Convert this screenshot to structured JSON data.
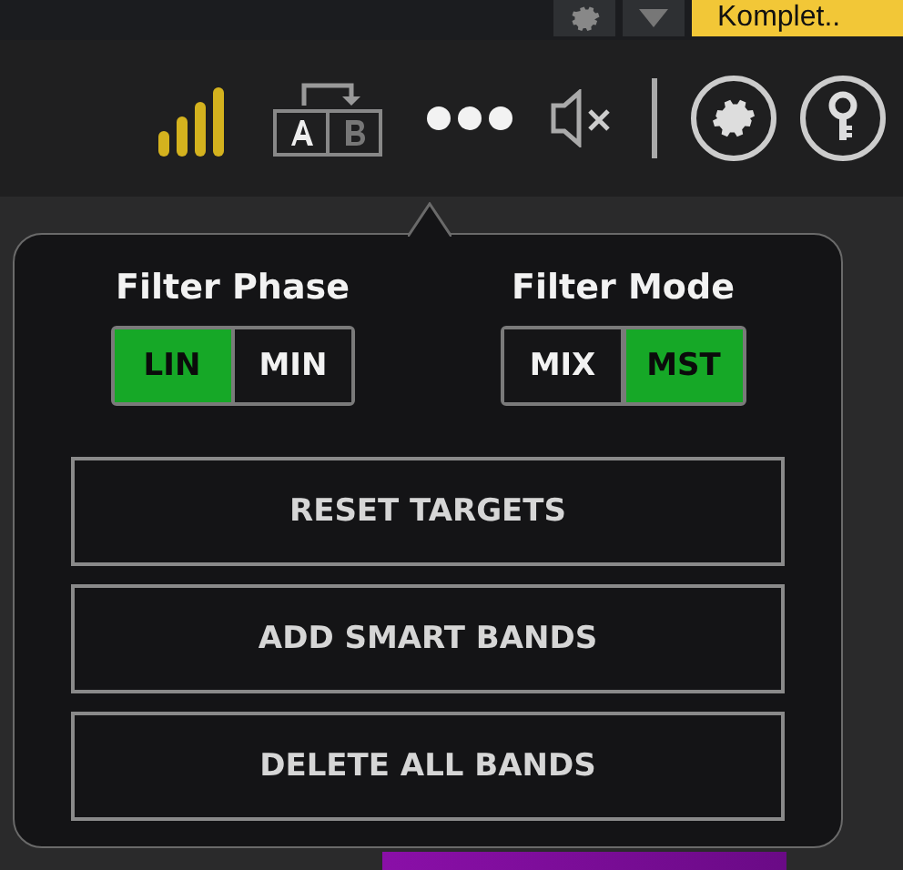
{
  "top_bar": {
    "preset": "Komplet.."
  },
  "popover": {
    "groups": [
      {
        "label": "Filter Phase",
        "options": [
          {
            "label": "LIN",
            "selected": true
          },
          {
            "label": "MIN",
            "selected": false
          }
        ]
      },
      {
        "label": "Filter Mode",
        "options": [
          {
            "label": "MIX",
            "selected": false
          },
          {
            "label": "MST",
            "selected": true
          }
        ]
      }
    ],
    "buttons": [
      "RESET TARGETS",
      "ADD SMART BANDS",
      "DELETE ALL BANDS"
    ]
  }
}
